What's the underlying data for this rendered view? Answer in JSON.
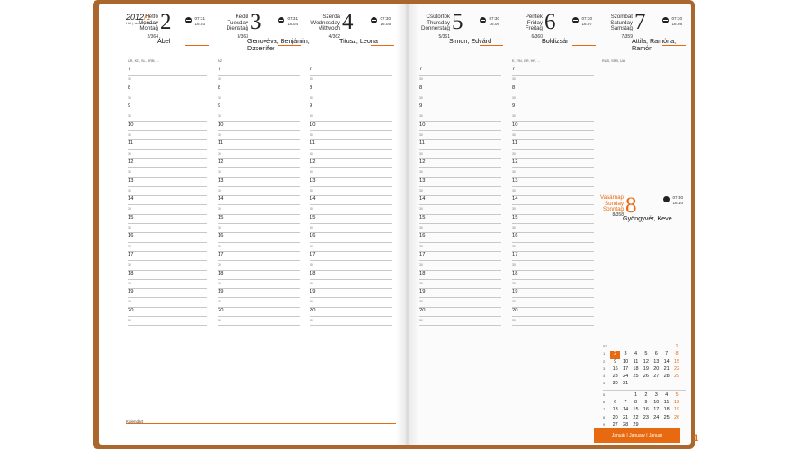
{
  "year": {
    "value": "2012",
    "suffix": "/1",
    "week": "Hét | week | Woche"
  },
  "left_page": {
    "days": [
      {
        "names": [
          "Hétfő",
          "Monday",
          "Montag"
        ],
        "number": "2",
        "day_no": "2/364",
        "nameday": "Ábel",
        "sunrise": "07:31",
        "sunset": "16:03",
        "holiday": "ÚR, KD, SL, SRB, ..."
      },
      {
        "names": [
          "Kedd",
          "Tuesday",
          "Dienstag"
        ],
        "number": "3",
        "day_no": "3/363",
        "nameday": "Genovéva, Benjámin, Dzsenifer",
        "sunrise": "07:31",
        "sunset": "16:04",
        "holiday": "NZ"
      },
      {
        "names": [
          "Szerda",
          "Wednesday",
          "Mittwoch"
        ],
        "number": "4",
        "day_no": "4/362",
        "nameday": "Titusz, Leona",
        "sunrise": "07:30",
        "sunset": "16:05",
        "holiday": ""
      }
    ],
    "logo": "Kalendart"
  },
  "right_page": {
    "days": [
      {
        "names": [
          "Csütörtök",
          "Thursday",
          "Donnerstag"
        ],
        "number": "5",
        "day_no": "5/361",
        "nameday": "Simon, Edvárd",
        "sunrise": "07:30",
        "sunset": "16:06",
        "holiday": ""
      },
      {
        "names": [
          "Péntek",
          "Friday",
          "Freitag"
        ],
        "number": "6",
        "day_no": "6/360",
        "nameday": "Boldizsár",
        "sunrise": "07:30",
        "sunset": "16:07",
        "holiday": "E, FIN, GR, HR, ..."
      },
      {
        "names": [
          "Szombat",
          "Saturday",
          "Samstag"
        ],
        "number": "7",
        "day_no": "7/359",
        "nameday": "Attila, Ramóna, Ramón",
        "sunrise": "07:30",
        "sunset": "16:08",
        "holiday": "RUS, SRB, UA"
      }
    ],
    "sunday": {
      "names": [
        "Vasárnap",
        "Sunday",
        "Sonntag"
      ],
      "number": "8",
      "day_no": "8/358",
      "nameday": "Gyöngyvér, Keve",
      "sunrise": "07:30",
      "sunset": "16:10"
    },
    "month_bar": "Január | January | Januar",
    "page_number": "1"
  },
  "hours": [
    "7",
    "8",
    "9",
    "10",
    "11",
    "12",
    "13",
    "14",
    "15",
    "16",
    "17",
    "18",
    "19",
    "20"
  ],
  "half_label": "30",
  "mini_calendar": {
    "rows": [
      {
        "week": "52",
        "days": [
          "",
          "",
          "",
          "",
          "",
          "",
          "1"
        ]
      },
      {
        "week": "1",
        "days": [
          "2",
          "3",
          "4",
          "5",
          "6",
          "7",
          "8"
        ]
      },
      {
        "week": "2",
        "days": [
          "9",
          "10",
          "11",
          "12",
          "13",
          "14",
          "15"
        ]
      },
      {
        "week": "3",
        "days": [
          "16",
          "17",
          "18",
          "19",
          "20",
          "21",
          "22"
        ]
      },
      {
        "week": "4",
        "days": [
          "23",
          "24",
          "25",
          "26",
          "27",
          "28",
          "29"
        ]
      },
      {
        "week": "5",
        "days": [
          "30",
          "31",
          "",
          "",
          "",
          "",
          ""
        ]
      },
      {
        "week": "5",
        "days": [
          "",
          "",
          "1",
          "2",
          "3",
          "4",
          "5"
        ]
      },
      {
        "week": "6",
        "days": [
          "6",
          "7",
          "8",
          "9",
          "10",
          "11",
          "12"
        ]
      },
      {
        "week": "7",
        "days": [
          "13",
          "14",
          "15",
          "16",
          "17",
          "18",
          "19"
        ]
      },
      {
        "week": "8",
        "days": [
          "20",
          "21",
          "22",
          "23",
          "24",
          "25",
          "26"
        ]
      },
      {
        "week": "9",
        "days": [
          "27",
          "28",
          "29",
          "",
          "",
          "",
          ""
        ]
      }
    ],
    "highlight": "2"
  },
  "colors": {
    "accent": "#e86a10",
    "cover": "#a9672d"
  }
}
